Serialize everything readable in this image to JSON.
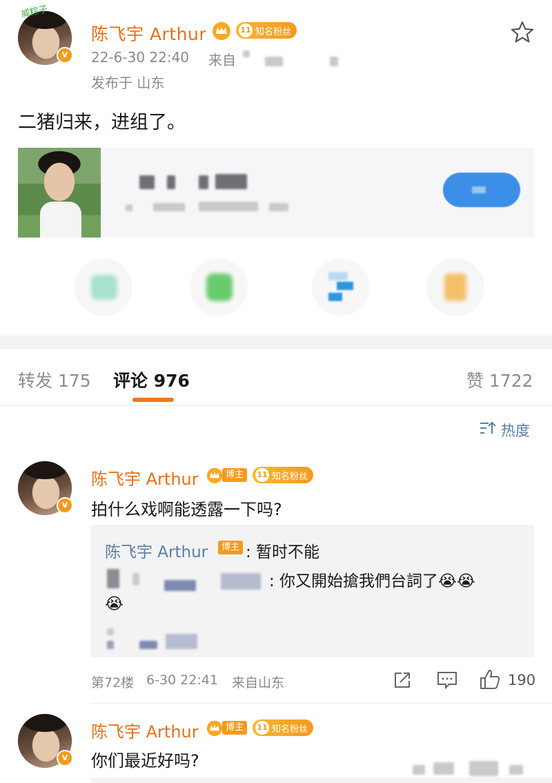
{
  "post": {
    "author": "陈飞宇 Arthur",
    "fan_badge": "知名粉丝",
    "fan_level": "11",
    "watermark": "威粽子",
    "date": "22-6-30 22:40",
    "source_prefix": "来自",
    "location": "发布于 山东",
    "text": "二猪归来，进组了。",
    "verified_mark": "v"
  },
  "tabs": {
    "repost": "转发 175",
    "comment": "评论 976",
    "like": "赞 1722"
  },
  "sort": {
    "label": "热度"
  },
  "comments": [
    {
      "author": "陈飞宇 Arthur",
      "host_badge": "博主",
      "fan_badge": "知名粉丝",
      "fan_level": "11",
      "text": "拍什么戏啊能透露一下吗?",
      "replies": [
        {
          "author": "陈飞宇 Arthur",
          "host_badge": "博主",
          "text": ": 暂时不能"
        },
        {
          "author": "",
          "text": ": 你又開始搶我們台詞了😭😭"
        },
        {
          "author": "",
          "text": "😭"
        }
      ],
      "floor": "第72楼",
      "time": "6-30 22:41",
      "from": "来自山东",
      "likes": "190"
    },
    {
      "author": "陈飞宇 Arthur",
      "host_badge": "博主",
      "fan_badge": "知名粉丝",
      "fan_level": "11",
      "text": "你们最近好吗?"
    }
  ],
  "colors": {
    "name_orange": "#e8701a",
    "link_blue": "#5a7ea8",
    "badge_orange": "#f49a1d",
    "tab_underline": "#f0761c"
  },
  "icons": [
    "star-icon",
    "crown-icon",
    "share-icon",
    "comment-icon",
    "like-icon",
    "sort-icon"
  ]
}
